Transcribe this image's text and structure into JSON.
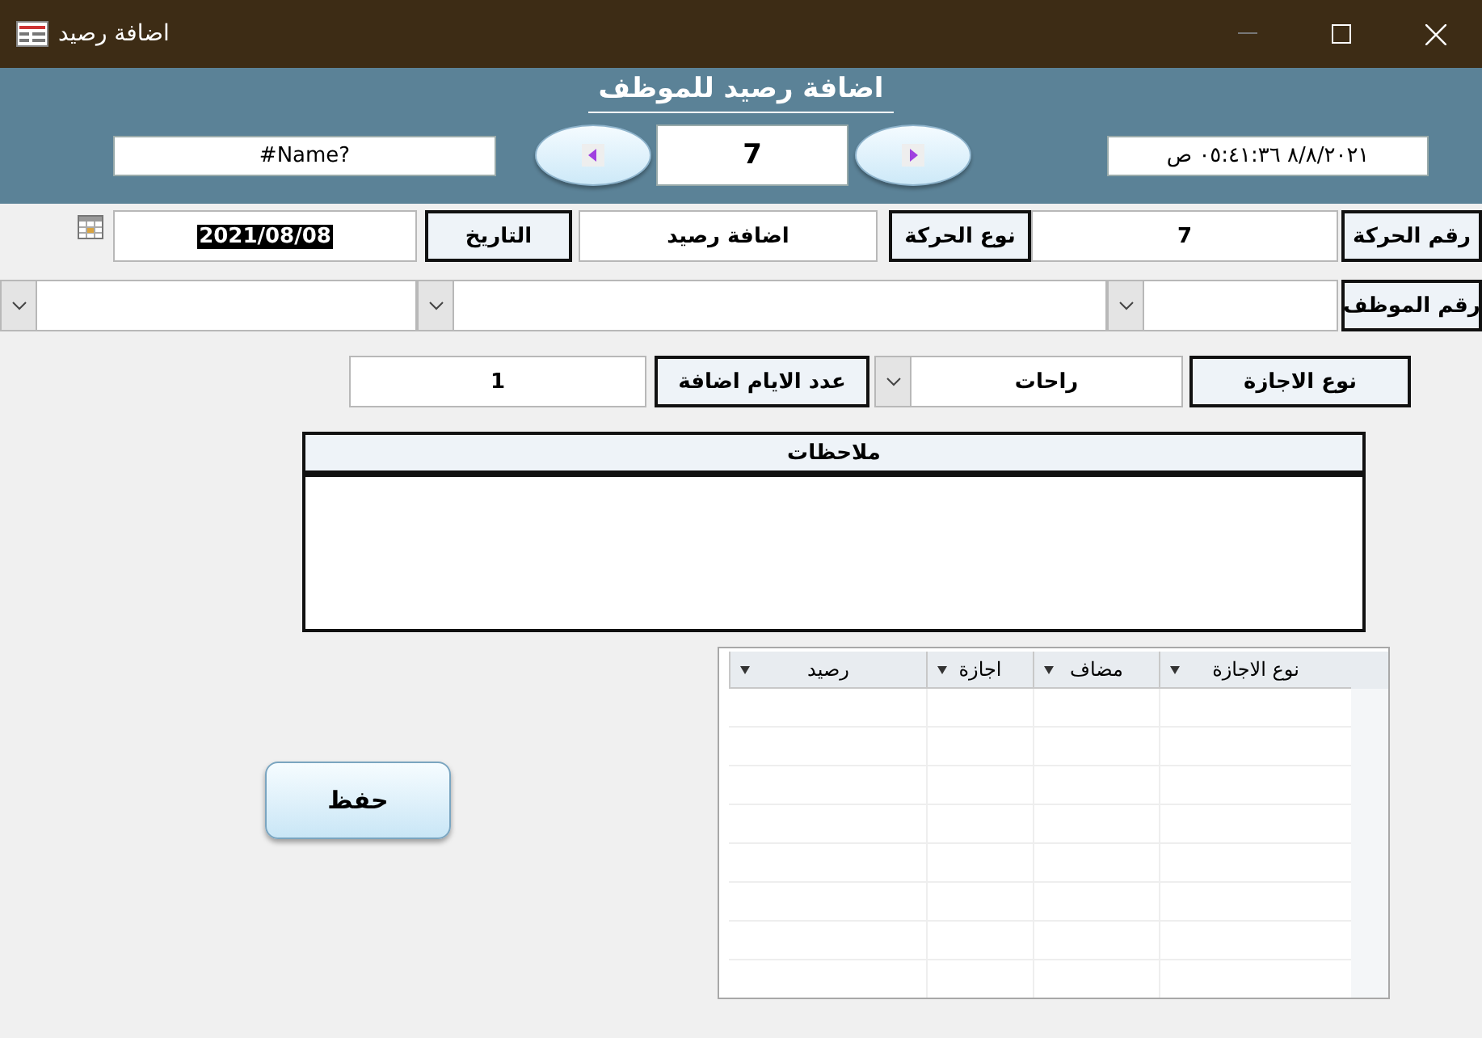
{
  "window": {
    "title": "اضافة رصيد"
  },
  "header": {
    "title": "اضافة رصيد للموظف",
    "lookup_value": "#Name?",
    "record_number": "7",
    "timestamp": "٨/٨/٢٠٢١ ٠٥:٤١:٣٦ ص"
  },
  "transaction_number": {
    "label": "رقم الحركة",
    "value": "7"
  },
  "transaction_type": {
    "label": "نوع الحركة",
    "value": "اضافة رصيد"
  },
  "date": {
    "label": "التاريخ",
    "value": "2021/08/08",
    "selected": true
  },
  "employee": {
    "label": "رقم الموظف"
  },
  "leave_type": {
    "label": "نوع الاجازة",
    "value": "راحات"
  },
  "days": {
    "label": "عدد الايام اضافة",
    "value": "1"
  },
  "notes": {
    "label": "ملاحظات"
  },
  "grid": {
    "columns": [
      "نوع الاجازة",
      "مضاف",
      "اجازة",
      "رصيد"
    ]
  },
  "save_button": "حفظ"
}
